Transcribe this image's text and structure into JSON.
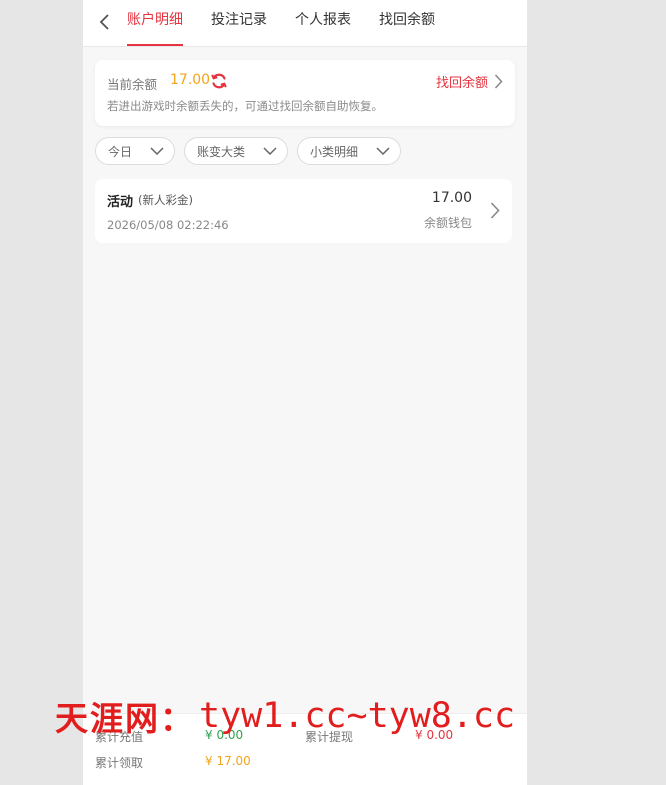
{
  "tabs": [
    "账户明细",
    "投注记录",
    "个人报表",
    "找回余额"
  ],
  "balance": {
    "label": "当前余额",
    "value": "17.00",
    "recover_label": "找回余额",
    "note": "若进出游戏时余额丢失的，可通过找回余额自助恢复。"
  },
  "filters": [
    "今日",
    "账变大类",
    "小类明细"
  ],
  "records": [
    {
      "title": "活动",
      "subtitle": "(新人彩金)",
      "date": "2026/05/08 02:22:46",
      "amount": "17.00",
      "wallet": "余额钱包"
    }
  ],
  "footer": {
    "recharge_label": "累计充值",
    "recharge_value": "¥ 0.00",
    "withdraw_label": "累计提现",
    "withdraw_value": "¥ 0.00",
    "claim_label": "累计领取",
    "claim_value": "¥ 17.00"
  },
  "watermark": {
    "cn": "天涯网：",
    "en": "tyw1.cc~tyw8.cc"
  },
  "icons": {
    "back": "chevron-left-icon",
    "refresh": "refresh-icon",
    "arrow": "chevron-right-icon",
    "dropdown": "chevron-down-icon"
  },
  "colors": {
    "accent": "#e5333f",
    "balance": "#f2a51a",
    "recharge": "#2ea44f"
  }
}
